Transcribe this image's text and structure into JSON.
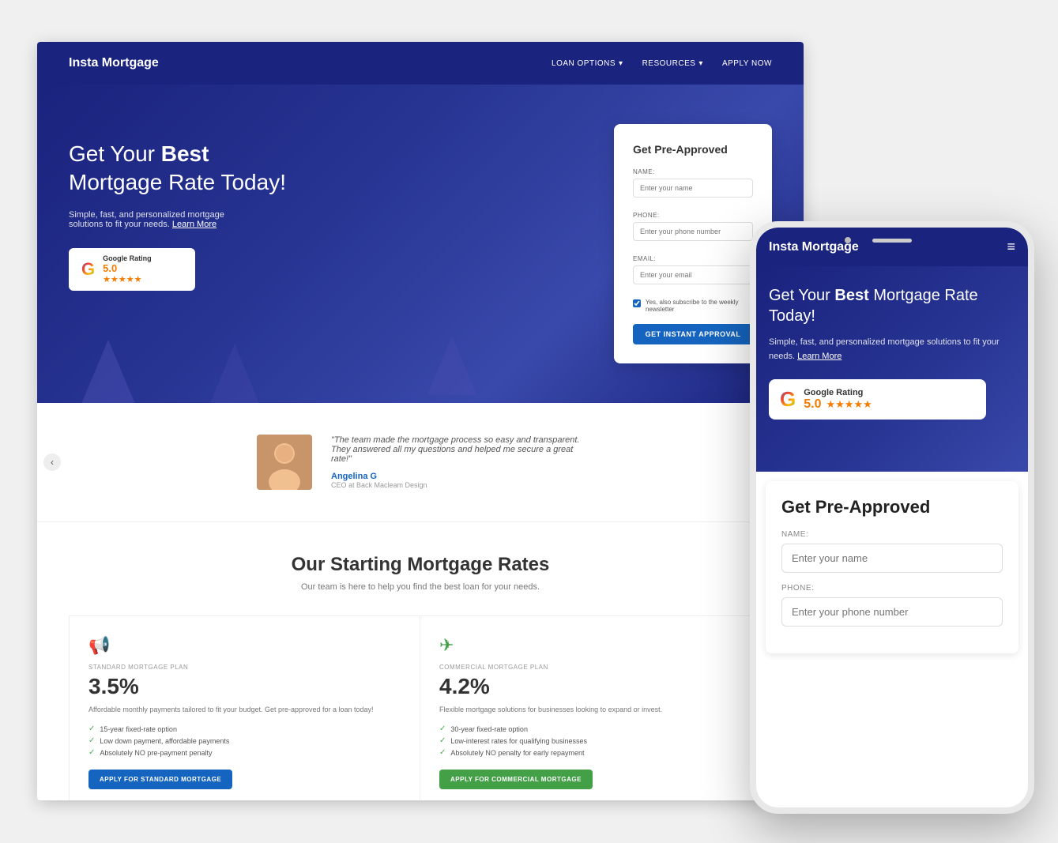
{
  "desktop": {
    "nav": {
      "logo": "Insta Mortgage",
      "links": [
        "LOAN OPTIONS",
        "RESOURCES",
        "APPLY NOW"
      ]
    },
    "hero": {
      "title_prefix": "Get Your ",
      "title_bold": "Best",
      "title_suffix": " Mortgage Rate Today!",
      "subtitle": "Simple, fast, and personalized mortgage solutions to fit your needs.",
      "learn_more": "Learn More",
      "google": {
        "label": "Google Rating",
        "score": "5.0",
        "stars": "★★★★★"
      }
    },
    "form": {
      "title": "Get Pre-Approved",
      "name_label": "NAME:",
      "name_placeholder": "Enter your name",
      "phone_label": "PHONE:",
      "phone_placeholder": "Enter your phone number",
      "email_label": "EMAIL:",
      "email_placeholder": "Enter your email",
      "checkbox_text": "Yes, also subscribe to the weekly newsletter",
      "button": "GET INSTANT APPROVAL"
    },
    "testimonial": {
      "quote": "\"The team made the mortgage process so easy and transparent. They answered all my questions and helped me secure a great rate!\"",
      "name": "Angelina G",
      "role": "CEO at Back Macleam Design"
    },
    "rates": {
      "title": "Our Starting Mortgage Rates",
      "subtitle": "Our team is here to help you find the best loan for your needs.",
      "plans": [
        {
          "icon": "📢",
          "label": "STANDARD MORTGAGE PLAN",
          "rate": "3.5%",
          "desc": "Affordable monthly payments tailored to fit your budget. Get pre-approved for a loan today!",
          "features": [
            "15-year fixed-rate option",
            "Low down payment, affordable payments",
            "Absolutely NO pre-payment penalty"
          ],
          "button": "APPLY FOR STANDARD MORTGAGE",
          "btn_type": "standard"
        },
        {
          "icon": "✈",
          "label": "COMMERCIAL MORTGAGE PLAN",
          "rate": "4.2%",
          "desc": "Flexible mortgage solutions for businesses looking to expand or invest.",
          "features": [
            "30-year fixed-rate option",
            "Low-interest rates for qualifying businesses",
            "Absolutely NO penalty for early repayment"
          ],
          "button": "APPLY FOR COMMERCIAL MORTGAGE",
          "btn_type": "commercial"
        }
      ]
    }
  },
  "mobile": {
    "logo": "Insta Mortgage",
    "hero": {
      "title_prefix": "Get Your ",
      "title_bold": "Best",
      "title_suffix": " Mortgage Rate Today!",
      "subtitle": "Simple, fast, and personalized mortgage solutions to fit your needs.",
      "learn_more": "Learn More",
      "google": {
        "label": "Google Rating",
        "score": "5.0",
        "stars": "★★★★★"
      }
    },
    "form": {
      "title": "Get Pre-Approved",
      "name_label": "NAME:",
      "name_placeholder": "Enter your name",
      "phone_label": "PHONE:",
      "phone_placeholder": "Enter your phone number"
    }
  }
}
